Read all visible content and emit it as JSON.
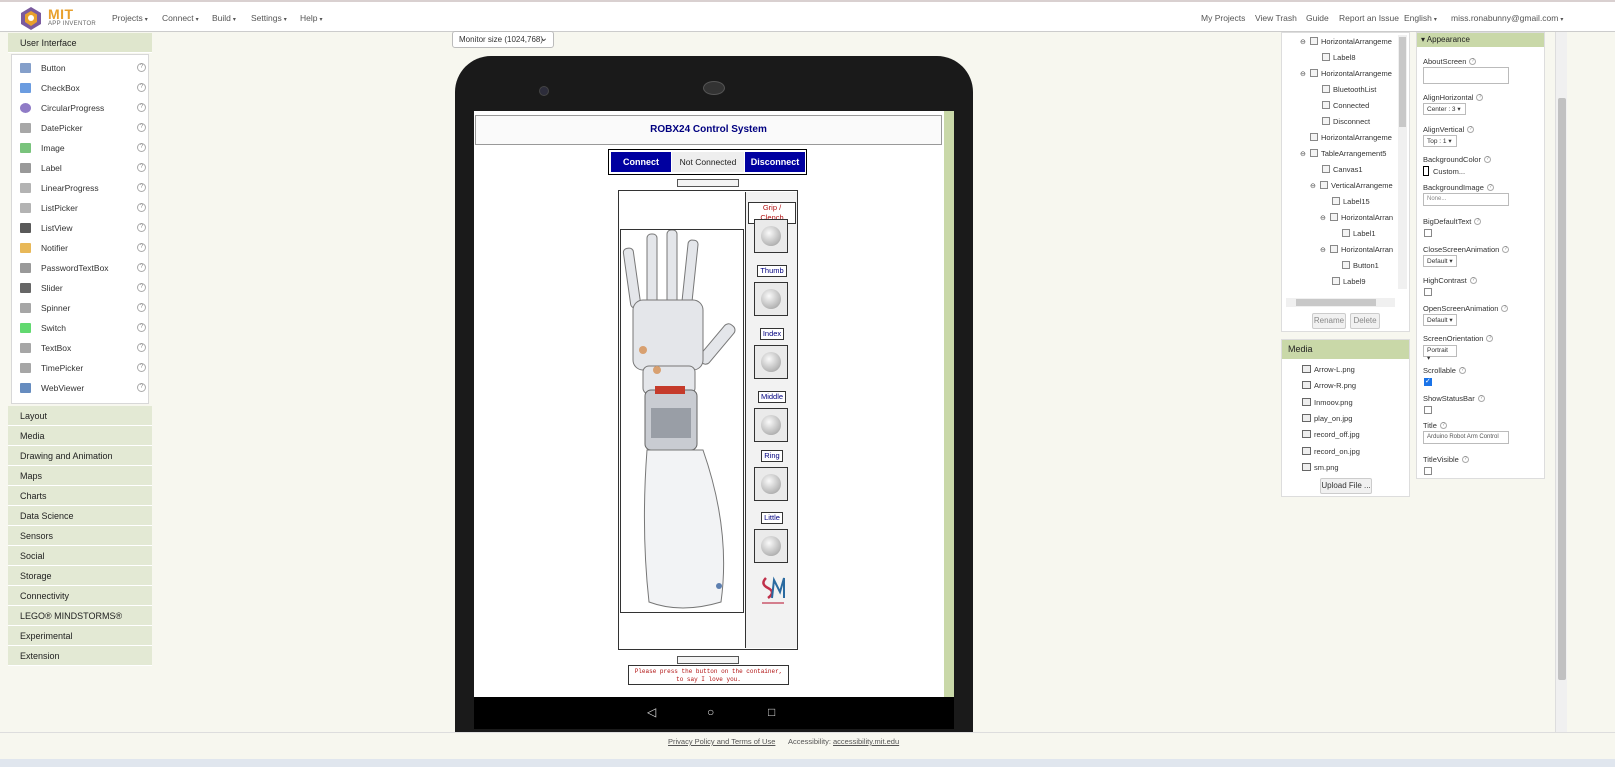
{
  "topbar": {
    "logo_main": "MIT",
    "logo_sub": "APP INVENTOR",
    "menus": [
      "Projects",
      "Connect",
      "Build",
      "Settings",
      "Help"
    ],
    "right_links": [
      "My Projects",
      "View Trash",
      "Guide",
      "Report an Issue"
    ],
    "language": "English",
    "user": "miss.ronabunny@gmail.com"
  },
  "palette": {
    "open_category": "User Interface",
    "items": [
      "Button",
      "CheckBox",
      "CircularProgress",
      "DatePicker",
      "Image",
      "Label",
      "LinearProgress",
      "ListPicker",
      "ListView",
      "Notifier",
      "PasswordTextBox",
      "Slider",
      "Spinner",
      "Switch",
      "TextBox",
      "TimePicker",
      "WebViewer"
    ],
    "categories": [
      "Layout",
      "Media",
      "Drawing and Animation",
      "Maps",
      "Charts",
      "Data Science",
      "Sensors",
      "Social",
      "Storage",
      "Connectivity",
      "LEGO® MINDSTORMS®",
      "Experimental",
      "Extension"
    ],
    "help_glyph": "?"
  },
  "viewer": {
    "monitor_size": "Monitor size (1024,768)",
    "app_title": "ROBX24 Control System",
    "connect_label": "Connect",
    "status_label": "Not Connected",
    "disconnect_label": "Disconnect",
    "fingers": [
      "Grip / Clench",
      "Thumb",
      "Index",
      "Middle",
      "Ring",
      "Little"
    ],
    "message_line1": "Please press the button on the container,",
    "message_line2": "to say I love you."
  },
  "tree": {
    "nodes": [
      {
        "label": "HorizontalArrangeme",
        "toggle": "⊖"
      },
      {
        "label": "Label8",
        "toggle": ""
      },
      {
        "label": "HorizontalArrangeme",
        "toggle": "⊖"
      },
      {
        "label": "BluetoothList",
        "toggle": ""
      },
      {
        "label": "Connected",
        "toggle": ""
      },
      {
        "label": "Disconnect",
        "toggle": ""
      },
      {
        "label": "HorizontalArrangeme",
        "toggle": ""
      },
      {
        "label": "TableArrangement5",
        "toggle": "⊖"
      },
      {
        "label": "Canvas1",
        "toggle": ""
      },
      {
        "label": "VerticalArrangeme",
        "toggle": "⊖"
      },
      {
        "label": "Label15",
        "toggle": ""
      },
      {
        "label": "HorizontalArran",
        "toggle": "⊖"
      },
      {
        "label": "Label1",
        "toggle": ""
      },
      {
        "label": "HorizontalArran",
        "toggle": "⊖"
      },
      {
        "label": "Button1",
        "toggle": ""
      },
      {
        "label": "Label9",
        "toggle": ""
      }
    ],
    "rename_label": "Rename",
    "delete_label": "Delete"
  },
  "media": {
    "title": "Media",
    "files": [
      "Arrow-L.png",
      "Arrow-R.png",
      "Inmoov.png",
      "play_on.jpg",
      "record_off.jpg",
      "record_on.jpg",
      "sm.png"
    ],
    "upload_label": "Upload File ..."
  },
  "properties": {
    "section": "Appearance",
    "about_screen": "AboutScreen",
    "align_horizontal": "AlignHorizontal",
    "align_horizontal_value": "Center : 3",
    "align_vertical": "AlignVertical",
    "align_vertical_value": "Top : 1",
    "background_color": "BackgroundColor",
    "background_color_value": "Custom...",
    "background_image": "BackgroundImage",
    "background_image_value": "None...",
    "big_default_text": "BigDefaultText",
    "close_screen_animation": "CloseScreenAnimation",
    "close_screen_animation_value": "Default",
    "high_contrast": "HighContrast",
    "open_screen_animation": "OpenScreenAnimation",
    "open_screen_animation_value": "Default",
    "screen_orientation": "ScreenOrientation",
    "screen_orientation_value": "Portrait",
    "scrollable": "Scrollable",
    "show_status_bar": "ShowStatusBar",
    "title": "Title",
    "title_value": "Arduino Robot Arm Control",
    "title_visible": "TitleVisible",
    "help_glyph": "?"
  },
  "footer": {
    "privacy": "Privacy Policy and Terms of Use",
    "accessibility_label": "Accessibility:",
    "accessibility_link": "accessibility.mit.edu"
  },
  "colors": {
    "accent_green": "#c9d8a8",
    "app_blue": "#0000a0",
    "brand_orange": "#e8a02c"
  }
}
